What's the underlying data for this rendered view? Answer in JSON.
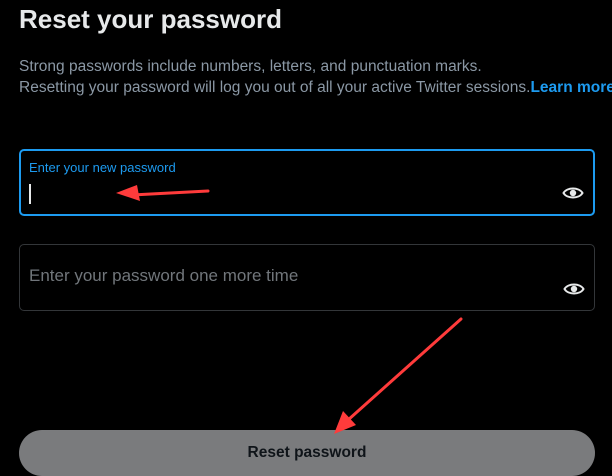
{
  "page": {
    "title": "Reset your password",
    "description_line1": "Strong passwords include numbers, letters, and punctuation marks.",
    "description_line2": "Resetting your password will log you out of all your active Twitter sessions.",
    "learn_more": "Learn more"
  },
  "fields": {
    "new_password": {
      "label": "Enter your new password",
      "value": "",
      "toggle_icon": "eye-icon"
    },
    "confirm_password": {
      "placeholder": "Enter your password one more time",
      "value": "",
      "toggle_icon": "eye-icon"
    }
  },
  "actions": {
    "reset_label": "Reset password"
  },
  "colors": {
    "background": "#000000",
    "accent": "#1d9bf0",
    "text_primary": "#e7e9ea",
    "text_secondary": "#8b98a5",
    "button_bg": "#7a7b7d",
    "annotation_arrow": "#ff3b3b"
  },
  "annotations": {
    "arrows": [
      "arrow-to-new-password-field",
      "arrow-to-reset-button"
    ]
  }
}
